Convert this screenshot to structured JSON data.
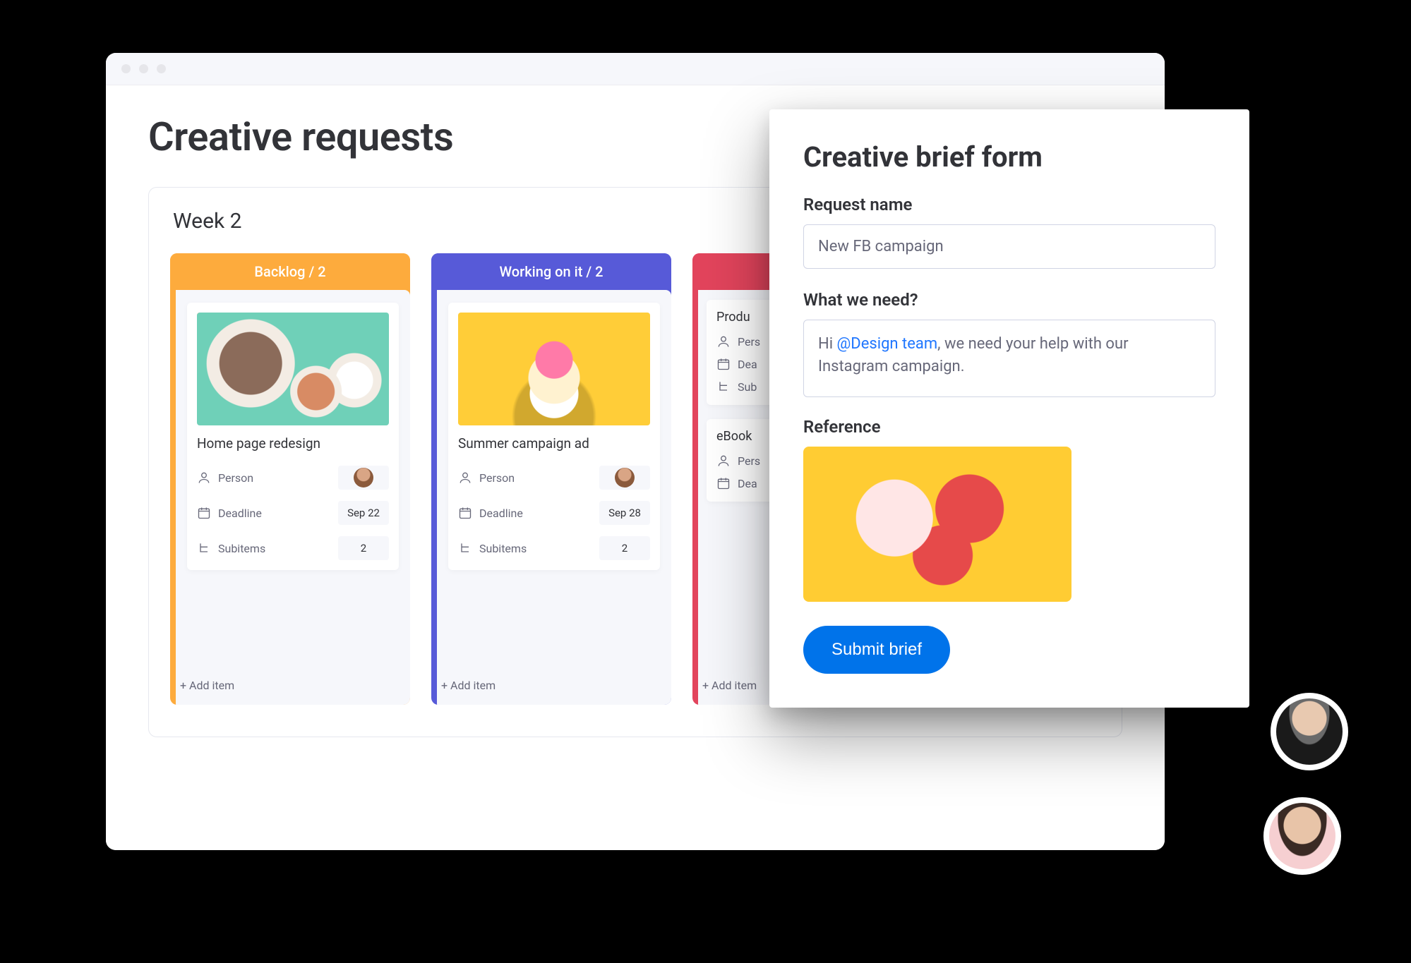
{
  "page": {
    "title": "Creative requests",
    "group": "Week 2"
  },
  "columns": [
    {
      "id": "backlog",
      "color": "orange",
      "header": "Backlog  / 2",
      "add_label": "+ Add item",
      "cards": [
        {
          "title": "Home page redesign",
          "person_label": "Person",
          "deadline_label": "Deadline",
          "deadline_value": "Sep 22",
          "subitems_label": "Subitems",
          "subitems_value": "2"
        }
      ]
    },
    {
      "id": "working",
      "color": "purple",
      "header": "Working on it  / 2",
      "add_label": "+ Add item",
      "cards": [
        {
          "title": "Summer campaign ad",
          "person_label": "Person",
          "deadline_label": "Deadline",
          "deadline_value": "Sep 28",
          "subitems_label": "Subitems",
          "subitems_value": "2"
        }
      ]
    },
    {
      "id": "third",
      "color": "pink",
      "header": "",
      "add_label": "+ Add item",
      "cards": [
        {
          "title": "Produ",
          "person_label": "Pers",
          "deadline_label": "Dea",
          "subitems_label": "Sub"
        },
        {
          "title": "eBook",
          "person_label": "Pers",
          "deadline_label": "Dea"
        }
      ]
    }
  ],
  "form": {
    "title": "Creative brief form",
    "request_name_label": "Request name",
    "request_name_value": "New FB campaign",
    "what_we_need_label": "What we need?",
    "what_we_need_prefix": "Hi ",
    "what_we_need_mention": "@Design team",
    "what_we_need_suffix": ", we need your help with our Instagram campaign.",
    "reference_label": "Reference",
    "submit_label": "Submit brief"
  }
}
